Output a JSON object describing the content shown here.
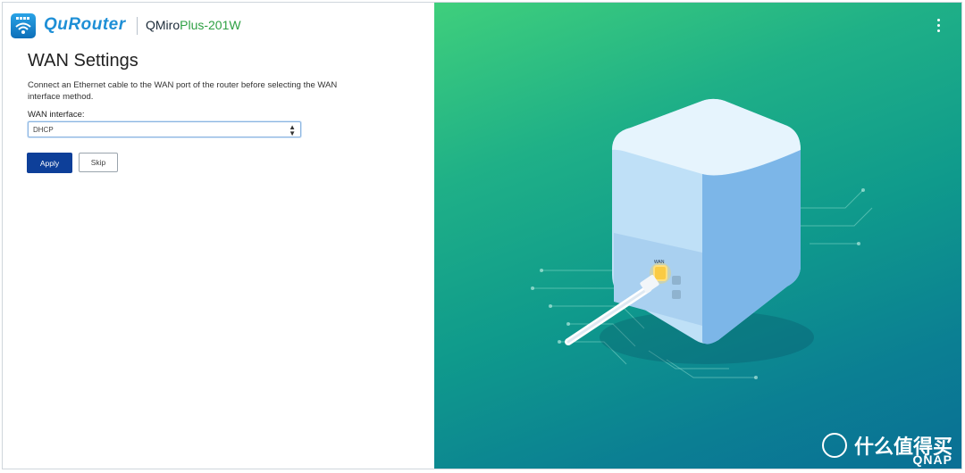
{
  "header": {
    "brand_label": "QuRouter",
    "model_prefix": "QMiro",
    "model_suffix": "Plus-201W"
  },
  "page": {
    "title": "WAN Settings",
    "description": "Connect an Ethernet cable to the WAN port of the router before selecting the WAN interface method."
  },
  "form": {
    "wan_interface_label": "WAN interface:",
    "wan_interface_value": "DHCP"
  },
  "actions": {
    "apply_label": "Apply",
    "skip_label": "Skip"
  },
  "illustration": {
    "port_label": "WAN"
  },
  "watermark": {
    "text": "什么值得买",
    "brand": "QNAP"
  },
  "colors": {
    "primary_button": "#0d3f99",
    "brand_blue": "#1e8fd6",
    "gradient_top": "#3fcf7c",
    "gradient_bottom": "#0a6f95"
  },
  "icons": {
    "app": "router-wifi-icon",
    "menu": "kebab-menu-icon",
    "select": "select-arrows-icon"
  }
}
